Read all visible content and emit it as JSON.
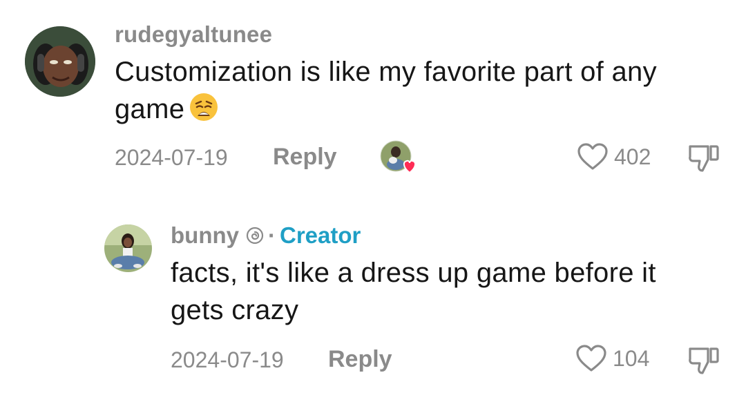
{
  "comments": [
    {
      "username": "rudegyaltunee",
      "text_line1": "Customization is like my favorite part of any",
      "text_line2": "game",
      "date": "2024-07-19",
      "reply_label": "Reply",
      "like_count": "402"
    }
  ],
  "reply": {
    "username": "bunny",
    "separator": "·",
    "badge": "Creator",
    "text_line1": "facts, it's like a dress up game before it",
    "text_line2": "gets crazy",
    "date": "2024-07-19",
    "reply_label": "Reply",
    "like_count": "104"
  },
  "icons": {
    "heart": "heart-outline-icon",
    "dislike": "thumbs-down-icon",
    "creator_liked": "creator-liked-heart-icon",
    "verified": "spiral-badge-icon",
    "emoji": "weary-face-emoji"
  },
  "colors": {
    "creator_accent": "#1f9fc5",
    "muted_text": "#8a8a8a",
    "body_text": "#161616",
    "liked_heart": "#fe2c55"
  }
}
